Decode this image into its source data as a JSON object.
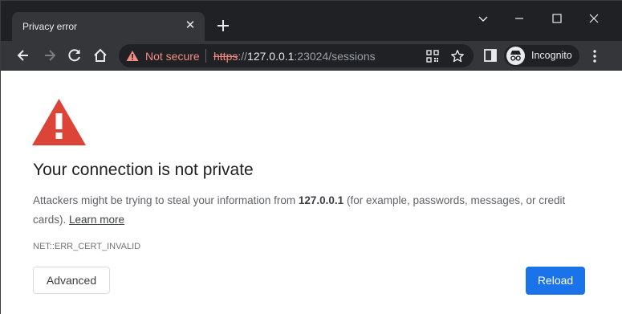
{
  "tab": {
    "title": "Privacy error"
  },
  "toolbar": {
    "security_label": "Not secure",
    "url_scheme": "https",
    "url_sep": "://",
    "url_host": "127.0.0.1",
    "url_rest": ":23024/sessions",
    "incognito_label": "Incognito"
  },
  "page": {
    "headline": "Your connection is not private",
    "desc_before": "Attackers might be trying to steal your information from ",
    "desc_host": "127.0.0.1",
    "desc_after": " (for example, passwords, messages, or credit cards). ",
    "learn_more": "Learn more",
    "error_code": "NET::ERR_CERT_INVALID",
    "advanced_button": "Advanced",
    "reload_button": "Reload"
  },
  "icons": {
    "tab_close": "close-icon",
    "new_tab": "plus-icon",
    "back": "arrow-left-icon",
    "forward": "arrow-right-icon",
    "reload": "reload-icon",
    "home": "home-icon",
    "not_secure": "warning-triangle-icon",
    "apps": "qr-code-icon",
    "bookmark": "star-icon",
    "side_panel": "side-panel-icon",
    "incognito": "incognito-icon",
    "menu": "kebab-menu-icon",
    "page_warning": "warning-triangle-icon"
  },
  "colors": {
    "frame": "#202124",
    "toolbar": "#35363a",
    "warning_red": "#db4437",
    "not_secure_red": "#f28b82",
    "primary_blue": "#1a73e8"
  }
}
